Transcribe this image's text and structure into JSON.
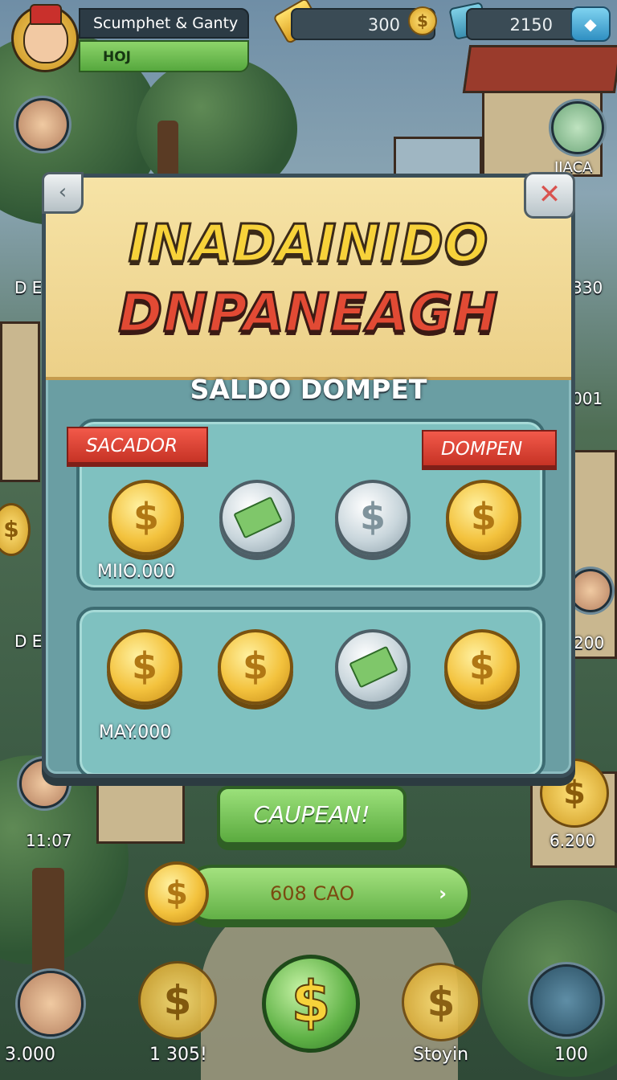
{
  "player": {
    "name": "Scumphet & Ganty",
    "tag": "HOJ"
  },
  "resources": {
    "gold": "300",
    "cash": "2150"
  },
  "side": {
    "right_top_label": "IIACA",
    "right_label_1": "330",
    "right_label_2": "001",
    "right_label_3": "200",
    "right_label_4": "6.200",
    "left_label_1": "D E",
    "left_label_2": "D E",
    "left_label_3": "11:07"
  },
  "modal": {
    "title_line1": "INADAINIDO",
    "title_line2": "DNPANEAGH",
    "subtitle": "SALDO DOMPET",
    "ribbon_left": "SACADOR",
    "ribbon_right": "DOMPEN",
    "panel1_amount": "MIIO.000",
    "panel2_amount": "MAY.000"
  },
  "actions": {
    "claim_label": "CAUPEAN!",
    "balance_label": "608 CAO",
    "balance_arrow": "›"
  },
  "bottom": {
    "item1_label": "3.000",
    "item2_label": "1 305!",
    "item4_label": "Stoyin",
    "item5_label": "100"
  },
  "icons": {
    "dollar": "$",
    "close": "✕",
    "back": "‹",
    "gem": "◆"
  },
  "colors": {
    "accent_green": "#5bab3f",
    "ribbon_red": "#c63325",
    "title_yellow": "#f7d23a",
    "title_red": "#e24a34"
  }
}
